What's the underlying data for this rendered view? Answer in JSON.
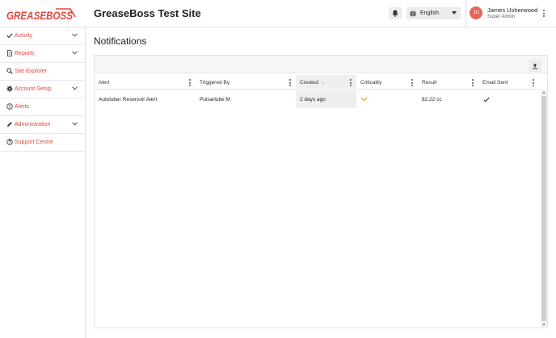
{
  "header": {
    "logo_text": "GREASEBOSS",
    "site_title": "GreaseBoss Test Site",
    "language": "English",
    "user": {
      "initials": "JU",
      "name": "James Usherwood",
      "role": "Super Admin"
    }
  },
  "sidebar": {
    "items": [
      {
        "label": "Activity",
        "icon": "check-icon",
        "expandable": true
      },
      {
        "label": "Reports",
        "icon": "document-icon",
        "expandable": true
      },
      {
        "label": "Site Explorer",
        "icon": "search-icon",
        "expandable": false
      },
      {
        "label": "Account Setup",
        "icon": "gear-icon",
        "expandable": true
      },
      {
        "label": "Alerts",
        "icon": "alert-circle-icon",
        "expandable": false
      },
      {
        "label": "Administration",
        "icon": "pencil-icon",
        "expandable": true
      },
      {
        "label": "Support Centre",
        "icon": "help-circle-icon",
        "expandable": false
      }
    ]
  },
  "main": {
    "page_title": "Notifications",
    "table": {
      "columns": [
        {
          "label": "Alert"
        },
        {
          "label": "Triggered By"
        },
        {
          "label": "Created",
          "sort": "descending"
        },
        {
          "label": "Criticality"
        },
        {
          "label": "Result"
        },
        {
          "label": "Email Sent"
        }
      ],
      "rows": [
        {
          "alert": "Autoluber Reservoir Alert",
          "triggered_by": "Pulsarlube M",
          "created": "2 days ago",
          "criticality_icon": "chevron-down-icon",
          "result": "82.22 cc",
          "email_sent_icon": "check-icon"
        }
      ]
    }
  },
  "colors": {
    "accent": "#e0473c",
    "avatar": "#e86556",
    "criticality": "#f0a030"
  }
}
